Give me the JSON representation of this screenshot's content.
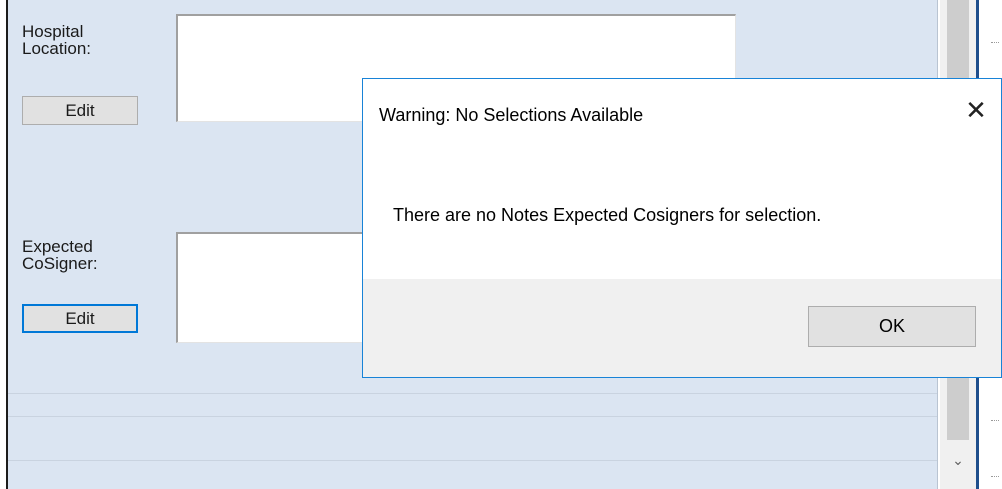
{
  "form": {
    "hospital_location": {
      "label": "Hospital\nLocation:",
      "edit_label": "Edit",
      "value": ""
    },
    "expected_cosigner": {
      "label": "Expected\nCoSigner:",
      "edit_label": "Edit",
      "value": ""
    }
  },
  "dialog": {
    "title": "Warning: No Selections Available",
    "close_glyph": "✕",
    "message": "There are no Notes Expected Cosigners for selection.",
    "ok_label": "OK"
  },
  "scrollbar": {
    "down_arrow": "⌄"
  },
  "colors": {
    "form_background": "#dbe5f2",
    "dialog_border": "#1883d7",
    "focus_border": "#0078d7"
  }
}
